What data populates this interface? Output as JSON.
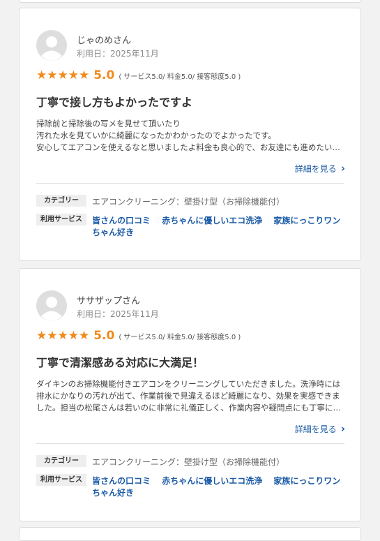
{
  "reviews": [
    {
      "reviewer": "じゃのめさん",
      "usage_date": "利用日：2025年11月",
      "stars": "★★★★★",
      "score": "5.0",
      "breakdown": "( サービス5.0/ 料金5.0/ 接客態度5.0 )",
      "title": "丁寧で接し方もよかったですよ",
      "body_lines": [
        "掃除前と掃除後の写メを見せて頂いたり",
        "汚れた水を見ていかに綺麗になったかわかったのでよかったです。",
        "安心してエアコンを使えるなと思いましたよ料金も良心的で、お友達にも進めたいと思います。"
      ],
      "detail_label": "詳細を見る",
      "category_tag": "カテゴリー",
      "category_value": "エアコンクリーニング：壁掛け型（お掃除機能付）",
      "services_tag": "利用サービス",
      "services": [
        "皆さんの口コミ",
        "赤ちゃんに優しいエコ洗浄",
        "家族にっこりワンちゃん好き"
      ]
    },
    {
      "reviewer": "ササザップさん",
      "usage_date": "利用日：2025年11月",
      "stars": "★★★★★",
      "score": "5.0",
      "breakdown": "( サービス5.0/ 料金5.0/ 接客態度5.0 )",
      "title": "丁寧で清潔感ある対応に大満足！",
      "body": "ダイキンのお掃除機能付きエアコンをクリーニングしていただきました。洗浄時には排水にかなりの汚れが出て、作業前後で見違えるほど綺麗になり、効果を実感できました。担当の松尾さんは若いのに非常に礼儀正しく、作業内容や疑問点にも丁寧に答えてくださいました。",
      "detail_label": "詳細を見る",
      "category_tag": "カテゴリー",
      "category_value": "エアコンクリーニング：壁掛け型（お掃除機能付）",
      "services_tag": "利用サービス",
      "services": [
        "皆さんの口コミ",
        "赤ちゃんに優しいエコ洗浄",
        "家族にっこりワンちゃん好き"
      ]
    }
  ]
}
